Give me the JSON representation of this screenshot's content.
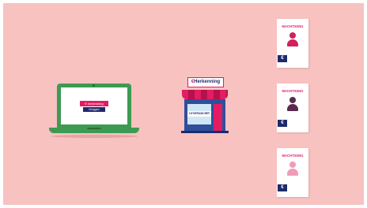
{
  "laptop": {
    "login_brand": "€ herkenning",
    "login_button": "Inloggen"
  },
  "shop": {
    "sign": "Herkenning",
    "sign_prefix": "€",
    "label": "LEVERANCIER"
  },
  "documents": [
    {
      "title": "MACHTIGING",
      "badge": "€",
      "person_color": "#d21f5d"
    },
    {
      "title": "MACHTIGING",
      "badge": "€",
      "person_color": "#5a2a4c"
    },
    {
      "title": "MACHTIGING",
      "badge": "€",
      "person_color": "#f09cb6"
    }
  ],
  "colors": {
    "background": "#f7c2c0",
    "brand_pink": "#e31c63",
    "brand_navy": "#1c2b6b",
    "laptop_green": "#3d9a52"
  }
}
